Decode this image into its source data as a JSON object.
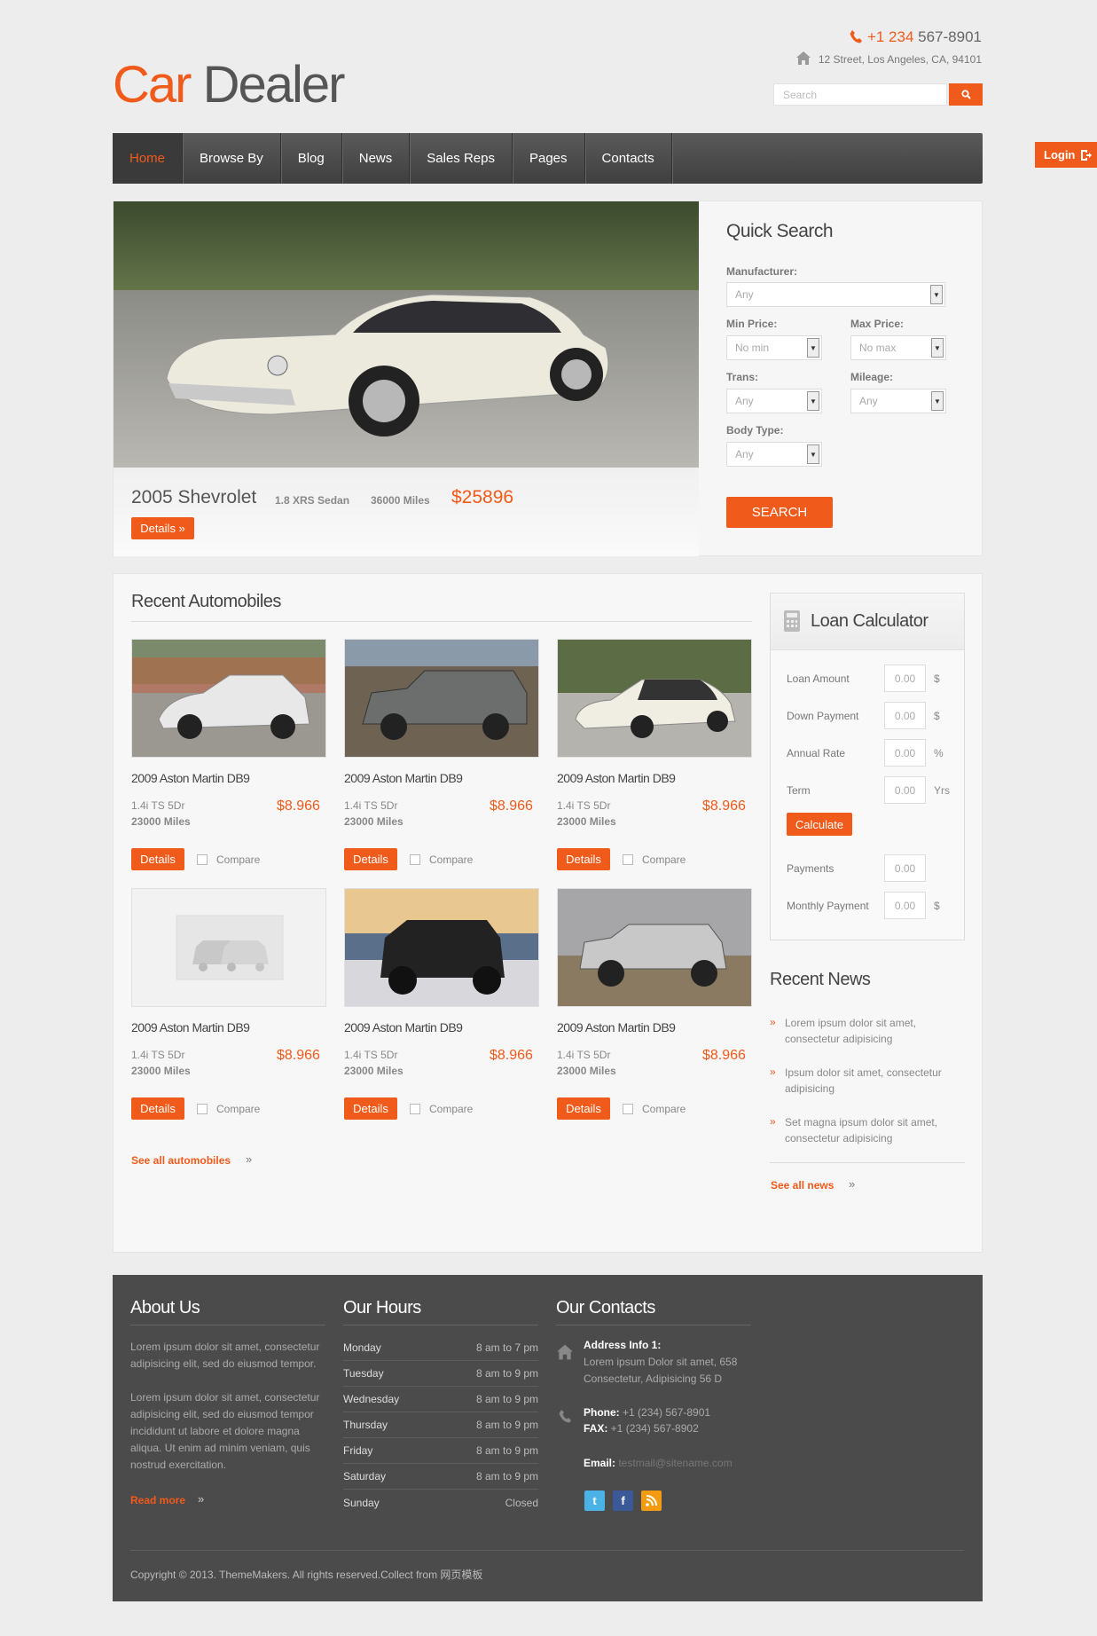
{
  "header": {
    "logo_part1": "Car",
    "logo_part2": " Dealer",
    "phone_prefix": "+1 234",
    "phone_number": " 567-8901",
    "address": "12 Street, Los Angeles, CA, 94101",
    "search_placeholder": "Search",
    "login_label": "Login"
  },
  "nav": {
    "items": [
      "Home",
      "Browse By",
      "Blog",
      "News",
      "Sales Reps",
      "Pages",
      "Contacts"
    ]
  },
  "hero": {
    "title": "2005 Shevrolet",
    "trim": "1.8 XRS Sedan",
    "miles": "36000 Miles",
    "price": "$25896",
    "details_label": "Details »"
  },
  "quick_search": {
    "title": "Quick Search",
    "manufacturer_label": "Manufacturer:",
    "manufacturer_value": "Any",
    "min_price_label": "Min Price:",
    "min_price_value": "No min",
    "max_price_label": "Max Price:",
    "max_price_value": "No max",
    "trans_label": "Trans:",
    "trans_value": "Any",
    "mileage_label": "Mileage:",
    "mileage_value": "Any",
    "body_label": "Body Type:",
    "body_value": "Any",
    "search_label": "SEARCH"
  },
  "recent": {
    "title": "Recent Automobiles",
    "cars": [
      {
        "name": "2009 Aston Martin DB9",
        "trim": "1.4i TS 5Dr",
        "miles": "23000 Miles",
        "price": "$8.966",
        "details": "Details",
        "compare": "Compare"
      },
      {
        "name": "2009 Aston Martin DB9",
        "trim": "1.4i TS 5Dr",
        "miles": "23000 Miles",
        "price": "$8.966",
        "details": "Details",
        "compare": "Compare"
      },
      {
        "name": "2009 Aston Martin DB9",
        "trim": "1.4i TS 5Dr",
        "miles": "23000 Miles",
        "price": "$8.966",
        "details": "Details",
        "compare": "Compare"
      },
      {
        "name": "2009 Aston Martin DB9",
        "trim": "1.4i TS 5Dr",
        "miles": "23000 Miles",
        "price": "$8.966",
        "details": "Details",
        "compare": "Compare"
      },
      {
        "name": "2009 Aston Martin DB9",
        "trim": "1.4i TS 5Dr",
        "miles": "23000 Miles",
        "price": "$8.966",
        "details": "Details",
        "compare": "Compare"
      },
      {
        "name": "2009 Aston Martin DB9",
        "trim": "1.4i TS 5Dr",
        "miles": "23000 Miles",
        "price": "$8.966",
        "details": "Details",
        "compare": "Compare"
      }
    ],
    "see_all": "See all automobiles"
  },
  "loan": {
    "title": "Loan Calculator",
    "rows": [
      {
        "label": "Loan Amount",
        "value": "0.00",
        "unit": "$"
      },
      {
        "label": "Down Payment",
        "value": "0.00",
        "unit": "$"
      },
      {
        "label": "Annual Rate",
        "value": "0.00",
        "unit": "%"
      },
      {
        "label": "Term",
        "value": "0.00",
        "unit": "Yrs"
      }
    ],
    "calculate_label": "Calculate",
    "results": [
      {
        "label": "Payments",
        "value": "0.00",
        "unit": ""
      },
      {
        "label": "Monthly Payment",
        "value": "0.00",
        "unit": "$"
      }
    ]
  },
  "news": {
    "title": "Recent News",
    "items": [
      "Lorem ipsum dolor sit amet, consectetur adipisicing",
      "Ipsum dolor sit amet, consectetur adipisicing",
      "Set magna ipsum dolor sit amet, consectetur adipisicing"
    ],
    "see_all": "See all news"
  },
  "footer": {
    "about_title": "About Us",
    "about_p1": "Lorem ipsum dolor sit amet, consectetur adipisicing elit, sed do eiusmod tempor.",
    "about_p2": "Lorem ipsum dolor sit amet, consectetur adipisicing elit, sed do eiusmod tempor incididunt ut labore et dolore magna aliqua. Ut enim ad minim veniam, quis nostrud exercitation.",
    "read_more": "Read more",
    "hours_title": "Our Hours",
    "hours": [
      {
        "day": "Monday",
        "time": "8 am to 7 pm"
      },
      {
        "day": "Tuesday",
        "time": "8 am to 9 pm"
      },
      {
        "day": "Wednesday",
        "time": "8 am to 9 pm"
      },
      {
        "day": "Thursday",
        "time": "8 am to 9 pm"
      },
      {
        "day": "Friday",
        "time": "8 am to 9 pm"
      },
      {
        "day": "Saturday",
        "time": "8 am to 9 pm"
      },
      {
        "day": "Sunday",
        "time": "Closed"
      }
    ],
    "contacts_title": "Our Contacts",
    "address_label": "Address Info 1:",
    "address_text": "Lorem ipsum Dolor sit amet, 658 Consectetur, Adipisicing 56 D",
    "phone_label": "Phone:",
    "phone_value": " +1 (234) 567-8901",
    "fax_label": "FAX:",
    "fax_value": " +1 (234) 567-8902",
    "email_label": "Email:",
    "email_value": " testmail@sitename.com",
    "copyright": "Copyright © 2013. ThemeMakers. All rights reserved.Collect from 网页模板"
  },
  "colors": {
    "accent": "#f05a1a",
    "nav": "#4a4a4a",
    "footer": "#4b4b4b"
  }
}
